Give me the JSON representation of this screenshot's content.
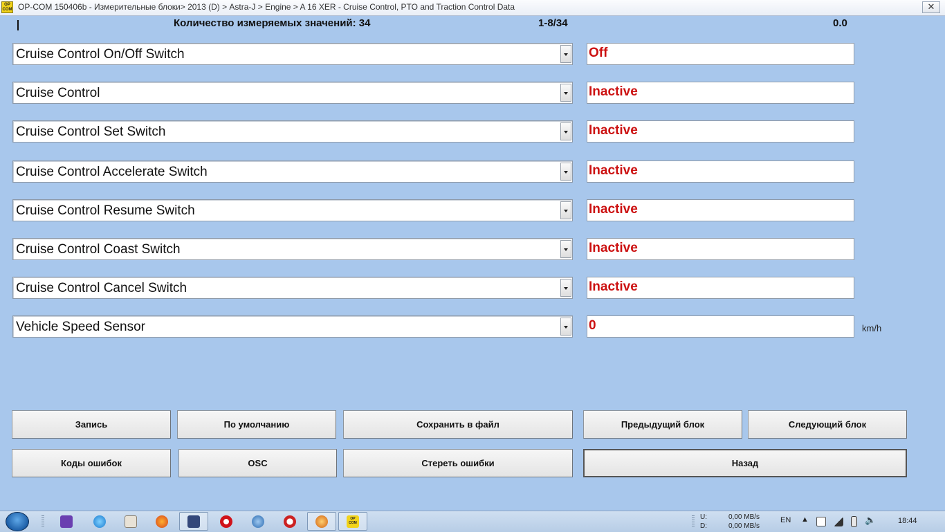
{
  "window": {
    "title": "OP-COM 150406b - Измерительные блоки> 2013 (D) > Astra-J > Engine > A 16 XER - Cruise Control, PTO and Traction Control Data",
    "app_icon_text": "OP COM",
    "close_label": "✕"
  },
  "header": {
    "count_label": "Количество измеряемых значений: 34",
    "range": "1-8/34",
    "value": "0.0"
  },
  "colors": {
    "background": "#a8c7ec",
    "value_text": "#cc1111"
  },
  "rows": [
    {
      "label": "Cruise Control On/Off Switch",
      "value": "Off",
      "unit": ""
    },
    {
      "label": "Cruise Control",
      "value": "Inactive",
      "unit": ""
    },
    {
      "label": "Cruise Control Set Switch",
      "value": "Inactive",
      "unit": ""
    },
    {
      "label": "Cruise Control Accelerate Switch",
      "value": "Inactive",
      "unit": ""
    },
    {
      "label": "Cruise Control Resume Switch",
      "value": "Inactive",
      "unit": ""
    },
    {
      "label": "Cruise Control Coast Switch",
      "value": "Inactive",
      "unit": ""
    },
    {
      "label": "Cruise Control Cancel Switch",
      "value": "Inactive",
      "unit": ""
    },
    {
      "label": "Vehicle Speed Sensor",
      "value": "0",
      "unit": "km/h"
    }
  ],
  "buttons": {
    "record": "Запись",
    "default": "По умолчанию",
    "save_file": "Сохранить в файл",
    "prev_block": "Предыдущий блок",
    "next_block": "Следующий блок",
    "error_codes": "Коды ошибок",
    "osc": "OSC",
    "clear_errors": "Стереть ошибки",
    "back": "Назад"
  },
  "taskbar": {
    "icons": [
      "windows-start-icon",
      "visual-studio-icon",
      "internet-explorer-icon",
      "app-icon",
      "firefox-icon",
      "save-disk-icon",
      "opera-icon",
      "network-icon",
      "stop-icon",
      "settings-icon",
      "op-com-icon"
    ],
    "opcom_label": "OP COM",
    "net_up_label": "U:",
    "net_down_label": "D:",
    "net_up": "0,00 MB/s",
    "net_down": "0,00 MB/s",
    "language": "EN",
    "time": "18:44"
  }
}
